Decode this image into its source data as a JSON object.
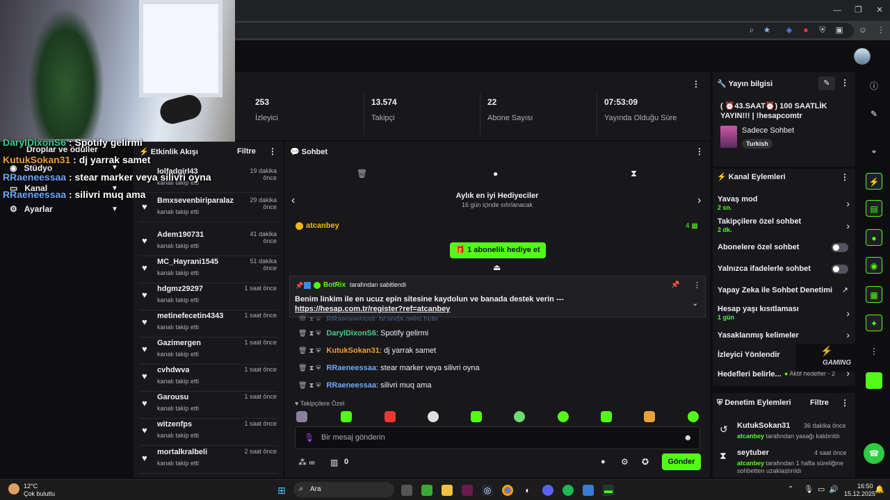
{
  "chrome": {
    "min": "—",
    "max": "❐",
    "close": "✕"
  },
  "stats": [
    {
      "value": "253",
      "label": "İzleyici"
    },
    {
      "value": "13.574",
      "label": "Takipçi"
    },
    {
      "value": "22",
      "label": "Abone Sayısı"
    },
    {
      "value": "07:53:09",
      "label": "Yayında Olduğu Süre"
    }
  ],
  "leftnav": {
    "items": [
      "Droplar ve ödüller",
      "Stüdyo",
      "Kanal",
      "Ayarlar"
    ]
  },
  "overlay_chat": [
    {
      "user": "DarylDixonS6",
      "msg": " : Spotify gelirmi",
      "color": "#3ecf8e"
    },
    {
      "user": "KutukSokan31",
      "msg": " : dj yarrak samet",
      "color": "#f0a030"
    },
    {
      "user": "RRaeneessaa",
      "msg": " : stear marker veya silivri oyna",
      "color": "#6ea8ff"
    },
    {
      "user": "RRaeneessaa",
      "msg": " : silivri muq ama",
      "color": "#6ea8ff"
    }
  ],
  "feed": {
    "title": "Etkinlik Akışı",
    "filter": "Filtre",
    "items": [
      {
        "name": "lolfadgirl43",
        "time": "19 dakika önce",
        "action": "kanalı takip etti"
      },
      {
        "name": "Bmxsevenbiriparalazimabii",
        "time": "29 dakika önce",
        "action": "kanalı takip etti"
      },
      {
        "name": "Adem190731",
        "time": "41 dakika önce",
        "action": "kanalı takip etti"
      },
      {
        "name": "MC_Hayrani1545",
        "time": "51 dakika önce",
        "action": "kanalı takip etti"
      },
      {
        "name": "hdgmz29297",
        "time": "1 saat önce",
        "action": "kanalı takip etti"
      },
      {
        "name": "metinefecetin4343",
        "time": "1 saat önce",
        "action": "kanalı takip etti"
      },
      {
        "name": "Gazimergen",
        "time": "1 saat önce",
        "action": "kanalı takip etti"
      },
      {
        "name": "cvhdwva",
        "time": "1 saat önce",
        "action": "kanalı takip etti"
      },
      {
        "name": "Garousu",
        "time": "1 saat önce",
        "action": "kanalı takip etti"
      },
      {
        "name": "witzenfps",
        "time": "1 saat önce",
        "action": "kanalı takip etti"
      },
      {
        "name": "mortalkralbeli",
        "time": "2 saat önce",
        "action": "kanalı takip etti"
      }
    ]
  },
  "chat": {
    "title": "Sohbet",
    "gifters_title": "Aylık en iyi Hediyeciler",
    "gifters_sub": "16 gün içinde sıfırlanacak",
    "top_gifter": "atcanbey",
    "top_gifter_count": "4",
    "gift_btn": "1 abonelik hediye et",
    "pinned_by_user": "BotRix",
    "pinned_by_text": "tarafından sabitlendi",
    "pinned_msg": "Benim linkim ile en ucuz epin sitesine kaydolun ve banada destek verin --- ",
    "pinned_link": "https://hesap.com.tr/register?ref=atcanbey",
    "partial_line": "RRaeneessaa: bi'anda gelsi bide",
    "messages": [
      {
        "user": "DarylDixonS6",
        "text": ": Spotify gelirmi",
        "color": "#3ecf8e"
      },
      {
        "user": "KutukSokan31",
        "text": ": dj yarrak samet",
        "color": "#f0a030"
      },
      {
        "user": "RRaeneessaa",
        "text": ": stear marker veya silivri oyna",
        "color": "#6ea8ff"
      },
      {
        "user": "RRaeneessaa",
        "text": ": silivri muq ama",
        "color": "#6ea8ff"
      }
    ],
    "followers_only": "Takipçilere Özel",
    "input_placeholder": "Bir mesaj gönderin",
    "points": "0",
    "send": "Gönder"
  },
  "info": {
    "title": "Yayın bilgisi",
    "stream_title": "( ⏰43.SAAT⏰) 100 SAATLİK YAYIN!!! | !hesapcomtr",
    "category": "Sadece Sohbet",
    "language": "Turkish"
  },
  "actions": {
    "title": "Kanal Eylemleri",
    "items": [
      {
        "label": "Yavaş mod",
        "sub": "2 sn."
      },
      {
        "label": "Takipçilere özel sohbet",
        "sub": "2 dk."
      },
      {
        "label": "Abonelere özel sohbet",
        "sub": ""
      },
      {
        "label": "Yalnızca ifadelerle sohbet",
        "sub": ""
      },
      {
        "label": "Yapay Zeka ile Sohbet Denetimi",
        "sub": ""
      },
      {
        "label": "Hesap yaşı kısıtlaması",
        "sub": "1 gün"
      },
      {
        "label": "Yasaklanmış kelimeler",
        "sub": ""
      },
      {
        "label": "İzleyici Yönlendir",
        "sub": ""
      },
      {
        "label": "Hedefleri belirle...",
        "sub": ""
      }
    ],
    "goals_status": "Aktif hedefler - 2",
    "watermark": "GAMING"
  },
  "mod": {
    "title": "Denetim Eylemleri",
    "filter": "Filtre",
    "items": [
      {
        "user": "KutukSokan31",
        "time": "36 dakika önce",
        "by": "atcanbey",
        "text": " tarafından yasağı kaldırıldı"
      },
      {
        "user": "seytuber",
        "time": "4 saat önce",
        "by": "atcanbey",
        "text": " tarafından 1 hafta süreliğine sohbetten uzaklaştırıldı"
      }
    ]
  },
  "taskbar": {
    "temp": "12°C",
    "weather": "Çok bulutlu",
    "search": "Ara",
    "time": "16:50",
    "date": "15.12.2025"
  }
}
